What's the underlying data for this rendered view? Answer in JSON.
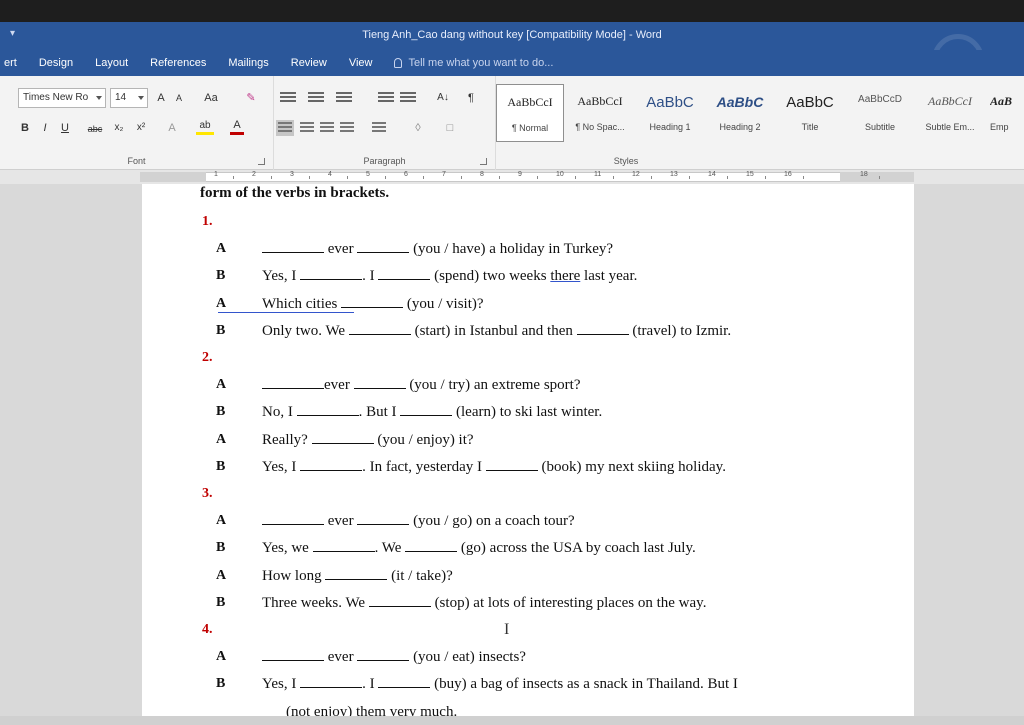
{
  "window": {
    "title": "Tieng Anh_Cao dang without key [Compatibility Mode] - Word",
    "qat_label": "▾"
  },
  "tabs": [
    "ert",
    "Design",
    "Layout",
    "References",
    "Mailings",
    "Review",
    "View"
  ],
  "tell_me": "Tell me what you want to do...",
  "ribbon": {
    "font": {
      "name": "Times New Ro",
      "size": "14",
      "grow": "A",
      "shrink": "A",
      "change_case": "Aa",
      "bold": "B",
      "italic": "I",
      "underline": "U",
      "strikethrough": "abc",
      "subscript": "x₂",
      "superscript": "x²",
      "font_color": "A",
      "group_label": "Font"
    },
    "paragraph": {
      "sort": "A↓",
      "pilcrow": "¶",
      "group_label": "Paragraph"
    },
    "styles": {
      "group_label": "Styles",
      "items": [
        {
          "sample": "AaBbCcI",
          "name": "¶ Normal"
        },
        {
          "sample": "AaBbCcI",
          "name": "¶ No Spac..."
        },
        {
          "sample": "AaBbC",
          "name": "Heading 1"
        },
        {
          "sample": "AaBbC",
          "name": "Heading 2"
        },
        {
          "sample": "AaBbC",
          "name": "Title"
        },
        {
          "sample": "AaBbCcD",
          "name": "Subtitle"
        },
        {
          "sample": "AaBbCcI",
          "name": "Subtle Em..."
        },
        {
          "sample": "AaB",
          "name": "Emp"
        }
      ]
    }
  },
  "ruler": {
    "numbers": [
      "1",
      "2",
      "3",
      "4",
      "5",
      "6",
      "7",
      "8",
      "9",
      "10",
      "11",
      "12",
      "13",
      "14",
      "15",
      "16",
      "18"
    ]
  },
  "document": {
    "cut_line": "form of the verbs in brackets.",
    "sections": [
      {
        "number": "1.",
        "lines": [
          {
            "speaker": "A",
            "parts": [
              "",
              " ever ",
              " (you / have) a holiday in Turkey?"
            ]
          },
          {
            "speaker": "B",
            "parts": [
              "Yes, I ",
              ". I ",
              " (spend) two weeks ",
              "there",
              " last year."
            ]
          },
          {
            "speaker": "A",
            "parts": [
              "Which cities ",
              " (you / visit)?"
            ]
          },
          {
            "speaker": "B",
            "parts": [
              "Only two. We ",
              " (start) in Istanbul and then ",
              " (travel) to Izmir."
            ]
          }
        ]
      },
      {
        "number": "2.",
        "lines": [
          {
            "speaker": "A",
            "parts": [
              "",
              "ever ",
              " (you / try) an extreme sport?"
            ]
          },
          {
            "speaker": "B",
            "parts": [
              "No, I ",
              ". But I ",
              " (learn) to ski last winter."
            ]
          },
          {
            "speaker": "A",
            "parts": [
              "Really? ",
              " (you / enjoy) it?"
            ]
          },
          {
            "speaker": "B",
            "parts": [
              "Yes, I ",
              ". In fact, yesterday I ",
              " (book) my next skiing holiday."
            ]
          }
        ]
      },
      {
        "number": "3.",
        "lines": [
          {
            "speaker": "A",
            "parts": [
              "",
              " ever ",
              " (you / go) on a coach tour?"
            ]
          },
          {
            "speaker": "B",
            "parts": [
              "Yes, we ",
              ". We ",
              " (go) across the USA by coach last July."
            ]
          },
          {
            "speaker": "A",
            "parts": [
              "How long ",
              " (it / take)?"
            ]
          },
          {
            "speaker": "B",
            "parts": [
              "Three weeks. We ",
              " (stop) at lots of interesting places on the way."
            ]
          }
        ]
      },
      {
        "number": "4.",
        "lines": [
          {
            "speaker": "A",
            "parts": [
              "",
              " ever ",
              " (you / eat) insects?"
            ]
          },
          {
            "speaker": "B",
            "parts": [
              "Yes, I ",
              ". I ",
              " (buy) a bag of insects as a snack in Thailand. But I"
            ]
          },
          {
            "speaker": "",
            "parts": [
              "(not enjoy) them very much."
            ]
          }
        ]
      }
    ]
  },
  "colors": {
    "word_blue": "#2b579a",
    "section_number_red": "#c00000"
  }
}
